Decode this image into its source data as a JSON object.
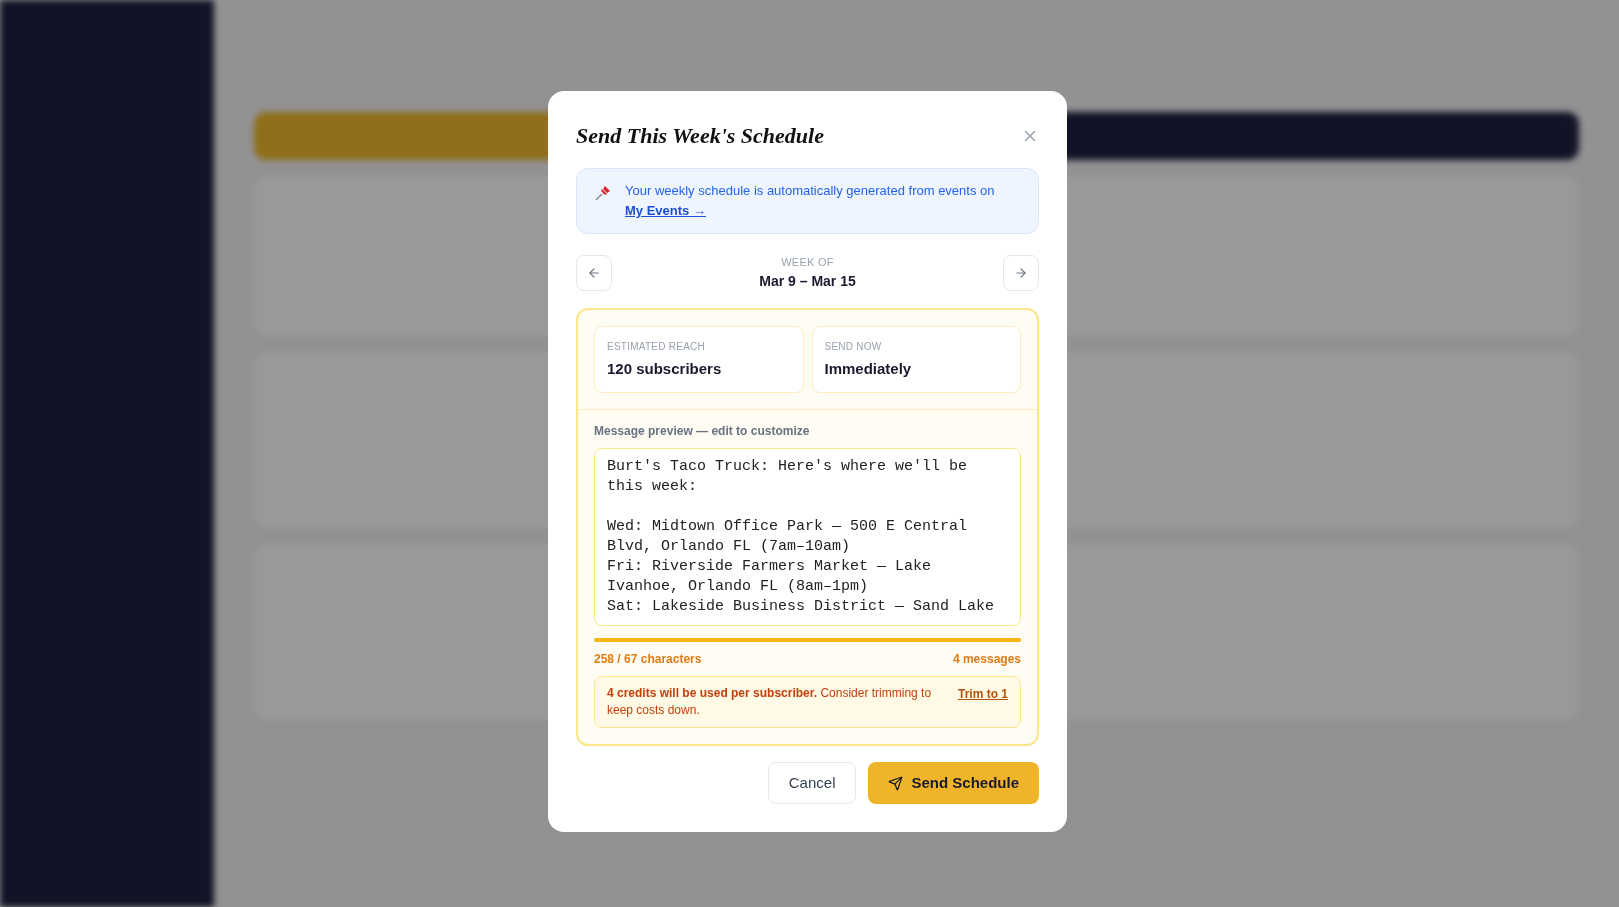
{
  "dialog": {
    "title": "Send This Week's Schedule",
    "info": {
      "text": "Your weekly schedule is automatically generated from events on",
      "link": "My Events →"
    },
    "week": {
      "label": "WEEK OF",
      "range": "Mar 9 – Mar 15"
    },
    "stats": [
      {
        "label": "ESTIMATED REACH",
        "value": "120 subscribers"
      },
      {
        "label": "SEND NOW",
        "value": "Immediately"
      }
    ],
    "preview": {
      "label": "Message preview — edit to customize",
      "value": "Burt's Taco Truck: Here's where we'll be this week:\n\nWed: Midtown Office Park — 500 E Central Blvd, Orlando FL (7am–10am)\nFri: Riverside Farmers Market — Lake Ivanhoe, Orlando FL (8am–1pm)\nSat: Lakeside Business District — Sand Lake"
    },
    "usage": {
      "level": 1,
      "characters": "258 / 67 characters",
      "messages": "4 messages"
    },
    "warning": {
      "text": "**4 credits will be used per subscriber.** Consider trimming to keep costs down.",
      "action": "Trim to 1"
    },
    "buttons": [
      {
        "label": "Cancel",
        "kind": "secondary"
      },
      {
        "label": "Send Schedule",
        "kind": "primary"
      }
    ]
  }
}
